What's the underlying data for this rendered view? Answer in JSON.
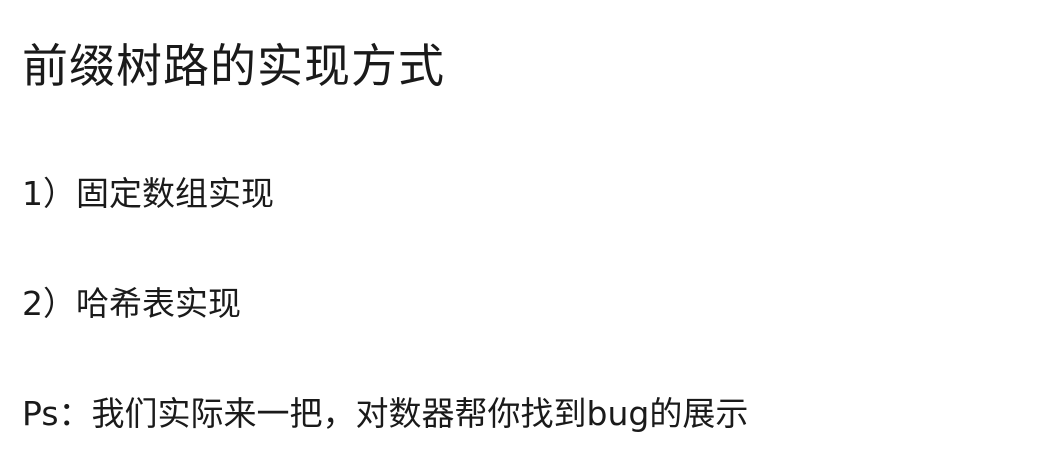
{
  "document": {
    "title": "前缀树路的实现方式",
    "lines": [
      "1）固定数组实现",
      "2）哈希表实现",
      "Ps：我们实际来一把，对数器帮你找到bug的展示"
    ]
  }
}
